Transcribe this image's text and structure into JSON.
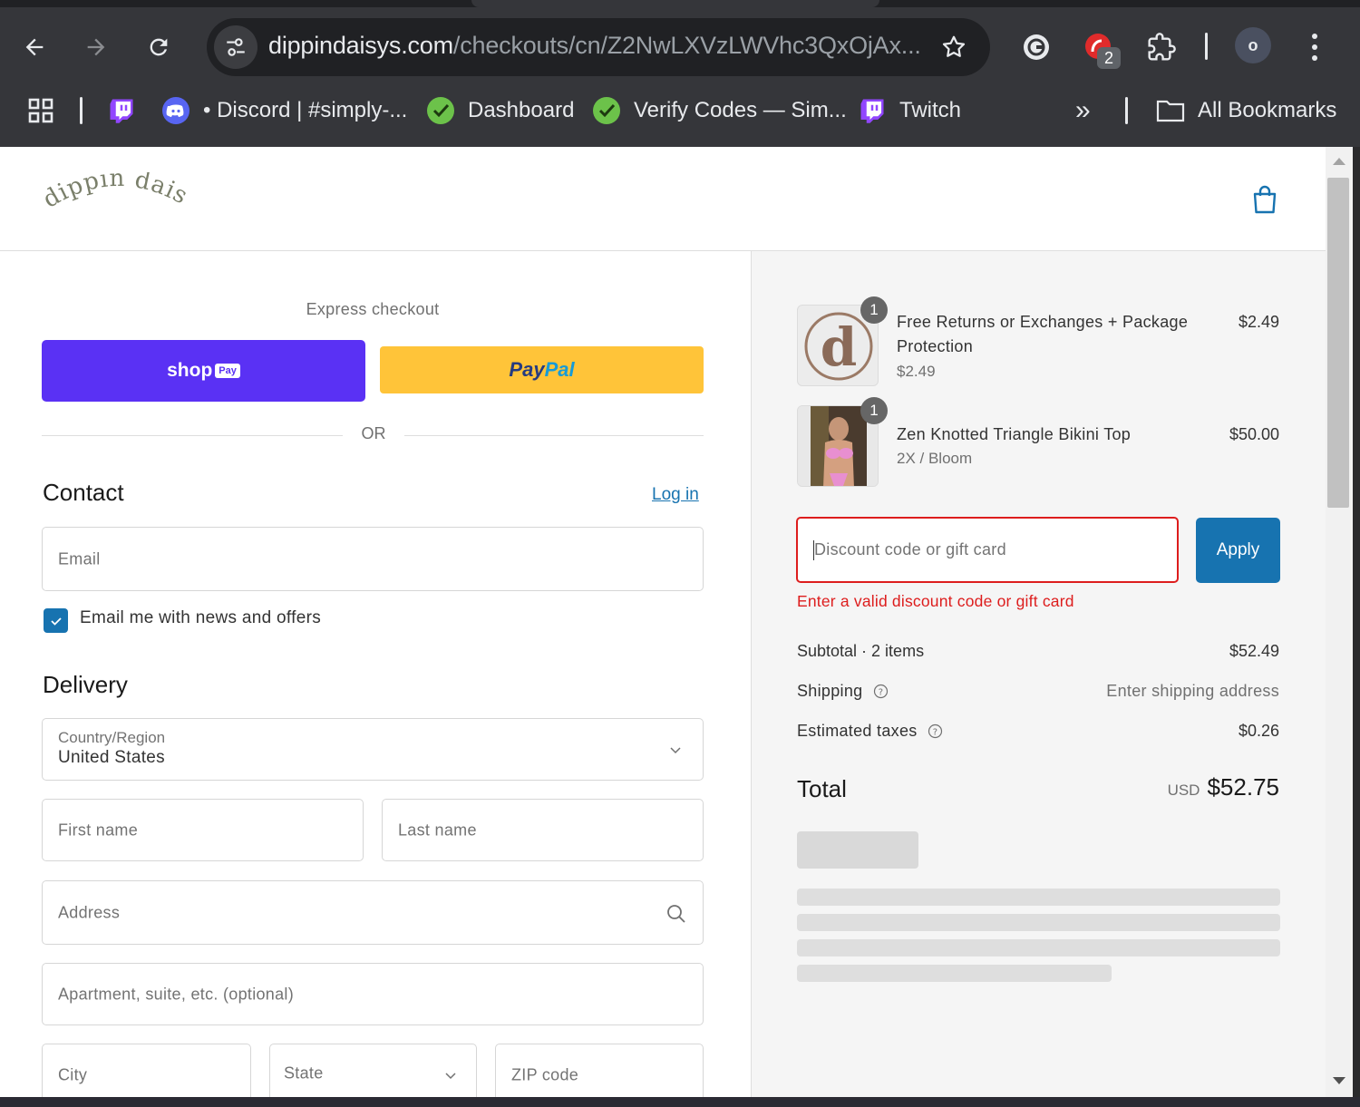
{
  "browser": {
    "url_host": "dippindaisys.com",
    "url_path": "/checkouts/cn/Z2NwLXVzLWVhc3QxOjAx...",
    "extension_badge": "2",
    "profile_initial": "o",
    "bookmarks": [
      {
        "label": "• Discord | #simply-..."
      },
      {
        "label": "Dashboard"
      },
      {
        "label": "Verify Codes — Sim..."
      },
      {
        "label": "Twitch"
      }
    ],
    "more_bookmarks": "»",
    "all_bookmarks": "All Bookmarks"
  },
  "header": {
    "logo_text": "dippin daisys"
  },
  "checkout": {
    "express_label": "Express checkout",
    "shop_pay_label": "shop",
    "shop_pay_badge": "Pay",
    "paypal_label_1": "Pay",
    "paypal_label_2": "Pal",
    "or_label": "OR",
    "contact_title": "Contact",
    "login_link": "Log in",
    "email_placeholder": "Email",
    "newsletter_label": "Email me with news and offers",
    "newsletter_checked": true,
    "delivery_title": "Delivery",
    "country_label": "Country/Region",
    "country_value": "United States",
    "first_name_placeholder": "First name",
    "last_name_placeholder": "Last name",
    "address_placeholder": "Address",
    "apartment_placeholder": "Apartment, suite, etc. (optional)",
    "city_placeholder": "City",
    "state_placeholder": "State",
    "zip_placeholder": "ZIP code"
  },
  "summary": {
    "items": [
      {
        "quantity": "1",
        "title_line1": "Free Returns or Exchanges + Package",
        "title_line2": "Protection",
        "subtitle": "$2.49",
        "price": "$2.49",
        "thumb_letter": "d"
      },
      {
        "quantity": "1",
        "title_line1": "Zen Knotted Triangle Bikini Top",
        "subtitle": "2X / Bloom",
        "price": "$50.00"
      }
    ],
    "discount_placeholder": "Discount code or gift card",
    "apply_label": "Apply",
    "discount_error": "Enter a valid discount code or gift card",
    "subtotal_label": "Subtotal · 2 items",
    "subtotal_value": "$52.49",
    "shipping_label": "Shipping",
    "shipping_value": "Enter shipping address",
    "taxes_label": "Estimated taxes",
    "taxes_value": "$0.26",
    "total_label": "Total",
    "total_currency": "USD",
    "total_value": "$52.75"
  },
  "colors": {
    "accent": "#1773b0",
    "shop_pay": "#5a31f4",
    "paypal": "#ffc439",
    "error": "#dd1d1d"
  }
}
